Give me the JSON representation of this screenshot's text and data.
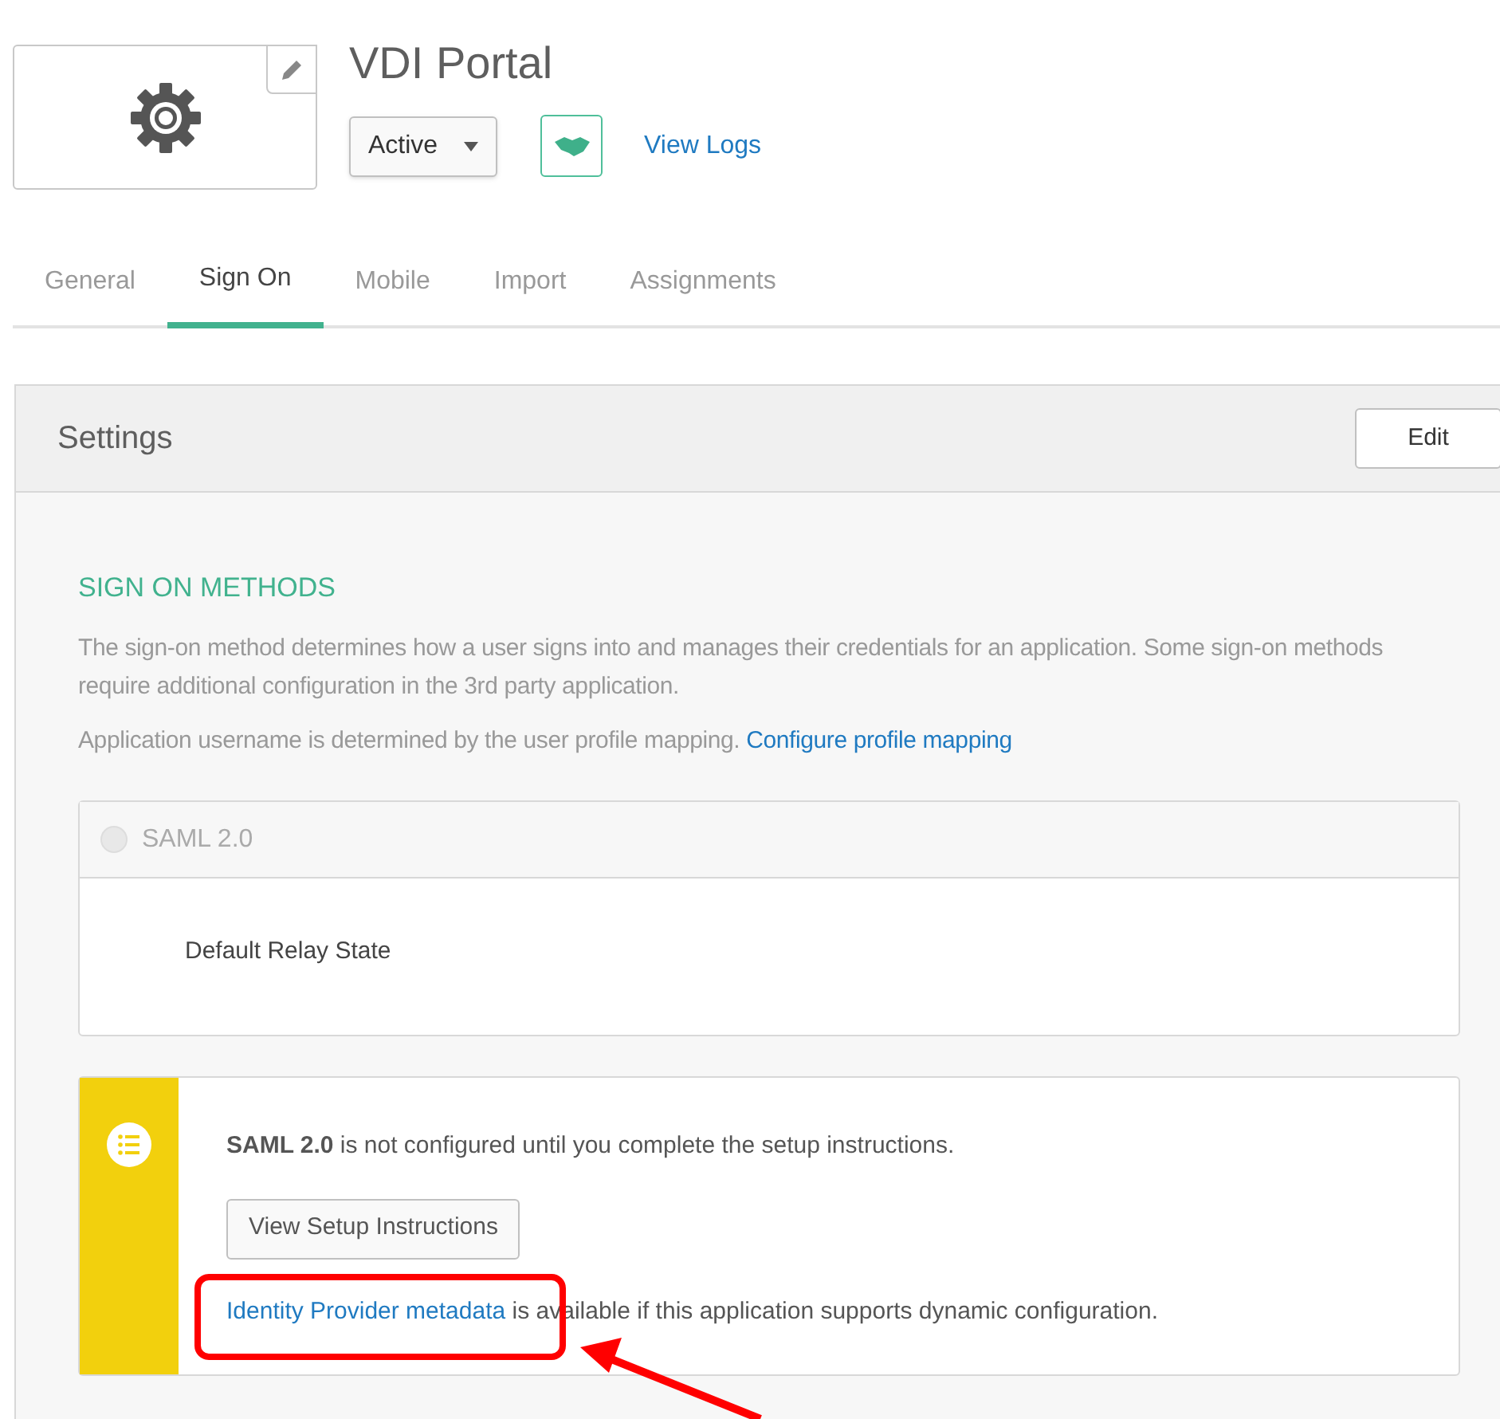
{
  "app": {
    "title": "VDI Portal",
    "status": "Active",
    "view_logs": "View Logs"
  },
  "tabs": [
    {
      "label": "General",
      "selected": false
    },
    {
      "label": "Sign On",
      "selected": true
    },
    {
      "label": "Mobile",
      "selected": false
    },
    {
      "label": "Import",
      "selected": false
    },
    {
      "label": "Assignments",
      "selected": false
    }
  ],
  "settings": {
    "title": "Settings",
    "edit": "Edit",
    "section_heading": "SIGN ON METHODS",
    "description": "The sign-on method determines how a user signs into and manages their credentials for an application. Some sign-on methods require additional configuration in the 3rd party application.",
    "username_note": "Application username is determined by the user profile mapping.",
    "username_link": "Configure profile mapping",
    "method": {
      "label": "SAML 2.0",
      "selected": false,
      "field_label": "Default Relay State"
    },
    "notice": {
      "message": "**SAML 2.0** is not configured until you complete the setup instructions.",
      "button": "View Setup Instructions",
      "link": "Identity Provider metadata",
      "link_suffix": "is available if this application supports dynamic configuration."
    }
  }
}
